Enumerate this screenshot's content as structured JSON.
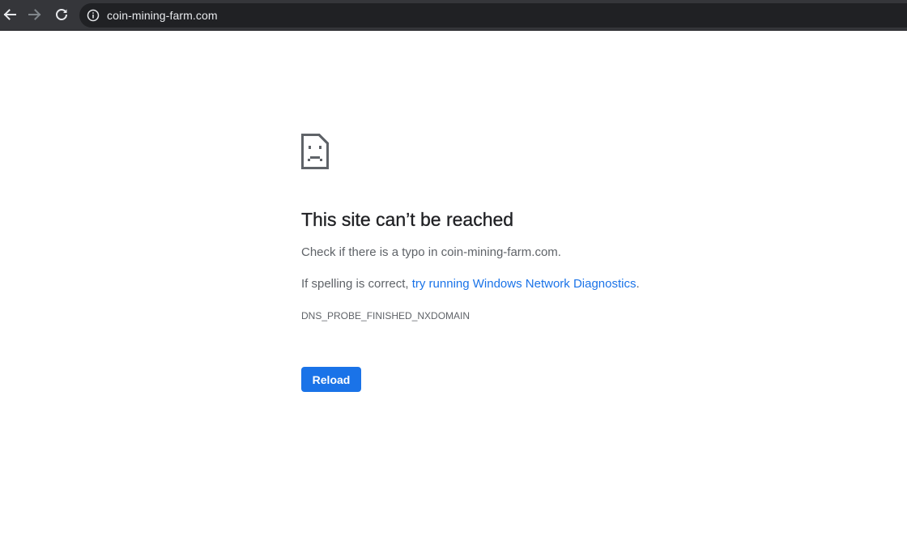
{
  "browser": {
    "url": "coin-mining-farm.com"
  },
  "error_page": {
    "title": "This site can’t be reached",
    "typo_prefix": "Check if there is a typo in ",
    "typo_domain": "coin-mining-farm.com",
    "typo_suffix": ".",
    "spelling_prefix": "If spelling is correct, ",
    "diagnostics_link": "try running Windows Network Diagnostics",
    "spelling_suffix": ".",
    "error_code": "DNS_PROBE_FINISHED_NXDOMAIN",
    "reload_label": "Reload"
  },
  "colors": {
    "toolbar_bg": "#35363a",
    "omnibox_bg": "#202124",
    "link": "#1a73e8",
    "button_bg": "#1a73e8"
  },
  "icons": {
    "back": "arrow-back-icon",
    "forward": "arrow-forward-icon",
    "reload": "reload-icon",
    "info": "info-icon",
    "error": "sad-page-icon"
  }
}
